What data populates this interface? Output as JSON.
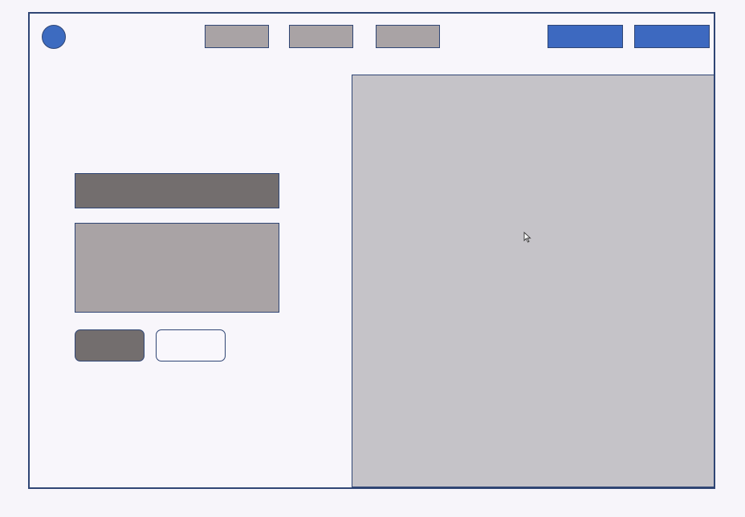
{
  "colors": {
    "background": "#f7f5fa",
    "frame_border": "#2f4574",
    "accent": "#3d6bc0",
    "nav_placeholder": "#a9a3a5",
    "dark_placeholder": "#736e6e",
    "image_placeholder": "#c5c3c8"
  },
  "header": {
    "nav_items": 3,
    "cta_buttons": 2
  },
  "icons": {
    "logo": "circle-logo",
    "cursor": "mouse-pointer-icon"
  }
}
